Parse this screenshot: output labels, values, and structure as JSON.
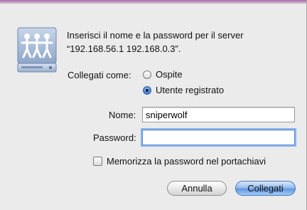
{
  "icon": "shared-server-icon",
  "message": {
    "line1": "Inserisci il nome e la password per il server",
    "line2": "“192.168.56.1 192.168.0.3”."
  },
  "connect_as": {
    "label": "Collegati come:",
    "options": [
      {
        "label": "Ospite",
        "selected": false
      },
      {
        "label": "Utente registrato",
        "selected": true
      }
    ]
  },
  "name_field": {
    "label": "Nome:",
    "value": "sniperwolf"
  },
  "password_field": {
    "label": "Password:",
    "value": ""
  },
  "remember": {
    "label": "Memorizza la password nel portachiavi",
    "checked": false
  },
  "buttons": {
    "cancel": "Annulla",
    "connect": "Collegati"
  },
  "colors": {
    "accent": "#5d95e0",
    "title_bar": "#a86aa8",
    "background": "#ebebeb"
  }
}
